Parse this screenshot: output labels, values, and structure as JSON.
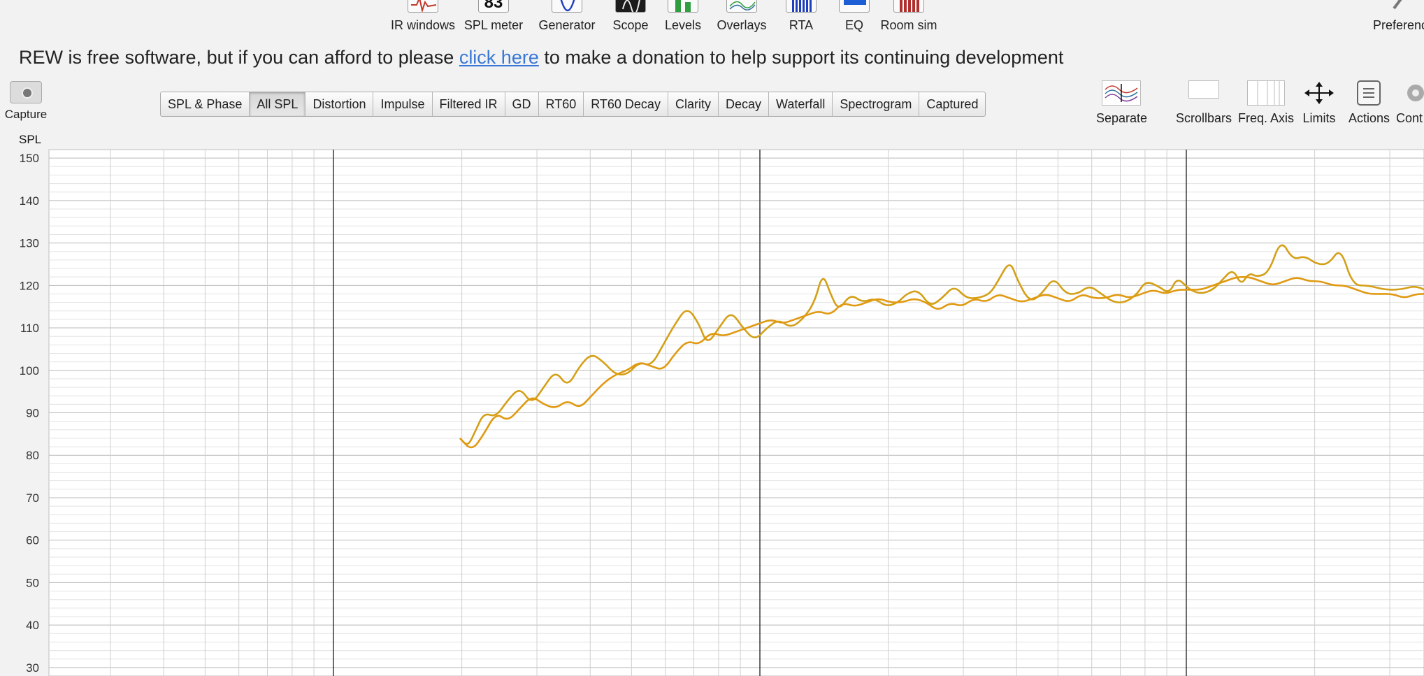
{
  "toolbar": {
    "items": [
      {
        "label": "IR windows",
        "icon": "ir-windows-icon"
      },
      {
        "label": "SPL meter",
        "icon": "spl-meter-icon",
        "display": "83"
      },
      {
        "label": "Generator",
        "icon": "generator-icon"
      },
      {
        "label": "Scope",
        "icon": "scope-icon"
      },
      {
        "label": "Levels",
        "icon": "levels-icon"
      },
      {
        "label": "Overlays",
        "icon": "overlays-icon"
      },
      {
        "label": "RTA",
        "icon": "rta-icon"
      },
      {
        "label": "EQ",
        "icon": "eq-icon"
      },
      {
        "label": "Room sim",
        "icon": "room-sim-icon"
      },
      {
        "label": "Preferenc",
        "icon": "preferences-icon"
      }
    ]
  },
  "donation": {
    "before": "REW is free software, but if you can afford to please ",
    "link": "click here",
    "after": " to make a donation to help support its continuing development"
  },
  "capture": {
    "label": "Capture",
    "icon": "camera-icon"
  },
  "tabs": {
    "items": [
      "SPL & Phase",
      "All SPL",
      "Distortion",
      "Impulse",
      "Filtered IR",
      "GD",
      "RT60",
      "RT60 Decay",
      "Clarity",
      "Decay",
      "Waterfall",
      "Spectrogram",
      "Captured"
    ],
    "active": "All SPL"
  },
  "graph_controls": {
    "items": [
      {
        "label": "Separate",
        "icon": "separate-icon"
      },
      {
        "label": "Scrollbars",
        "icon": "scrollbars-icon"
      },
      {
        "label": "Freq. Axis",
        "icon": "freq-axis-icon"
      },
      {
        "label": "Limits",
        "icon": "limits-icon"
      },
      {
        "label": "Actions",
        "icon": "actions-icon"
      },
      {
        "label": "Cont",
        "icon": "controls-icon"
      }
    ]
  },
  "colors": {
    "trace_1": "#d4a017",
    "trace_2": "#e09a12",
    "grid": "#c8c8c8",
    "grid_major": "#3a3a3a",
    "plot_bg": "#ffffff"
  },
  "chart_data": {
    "type": "line",
    "ylabel": "SPL",
    "y_ticks": [
      150,
      140,
      130,
      120,
      110,
      100,
      90,
      80,
      70,
      60,
      50,
      40,
      30
    ],
    "ylim": [
      28,
      152
    ],
    "x_scale": "log",
    "grid": true,
    "series": [
      {
        "values_note": "",
        "points": [
          [
            0.0,
            84
          ],
          [
            0.01,
            82
          ],
          [
            0.02,
            86
          ],
          [
            0.03,
            90
          ],
          [
            0.045,
            89
          ],
          [
            0.06,
            93
          ],
          [
            0.075,
            96
          ],
          [
            0.09,
            92
          ],
          [
            0.105,
            96
          ],
          [
            0.12,
            100
          ],
          [
            0.135,
            96
          ],
          [
            0.15,
            101
          ],
          [
            0.165,
            104
          ],
          [
            0.18,
            102
          ],
          [
            0.195,
            99
          ],
          [
            0.21,
            99
          ],
          [
            0.225,
            102
          ],
          [
            0.24,
            101
          ],
          [
            0.255,
            106
          ],
          [
            0.27,
            111
          ],
          [
            0.285,
            115
          ],
          [
            0.3,
            111
          ],
          [
            0.31,
            106
          ],
          [
            0.325,
            110
          ],
          [
            0.34,
            114
          ],
          [
            0.355,
            110
          ],
          [
            0.37,
            107
          ],
          [
            0.385,
            110
          ],
          [
            0.4,
            112
          ],
          [
            0.415,
            110
          ],
          [
            0.43,
            112
          ],
          [
            0.445,
            116
          ],
          [
            0.455,
            123
          ],
          [
            0.465,
            118
          ],
          [
            0.475,
            114
          ],
          [
            0.49,
            118
          ],
          [
            0.505,
            116
          ],
          [
            0.52,
            117
          ],
          [
            0.535,
            115
          ],
          [
            0.55,
            116
          ],
          [
            0.56,
            118
          ],
          [
            0.575,
            119
          ],
          [
            0.59,
            115
          ],
          [
            0.605,
            117
          ],
          [
            0.62,
            120
          ],
          [
            0.635,
            117
          ],
          [
            0.65,
            117
          ],
          [
            0.665,
            118
          ],
          [
            0.675,
            121
          ],
          [
            0.69,
            126
          ],
          [
            0.7,
            121
          ],
          [
            0.715,
            116
          ],
          [
            0.73,
            118
          ],
          [
            0.745,
            122
          ],
          [
            0.76,
            118
          ],
          [
            0.775,
            118
          ],
          [
            0.79,
            120
          ],
          [
            0.805,
            118
          ],
          [
            0.82,
            116
          ],
          [
            0.835,
            116
          ],
          [
            0.85,
            118
          ],
          [
            0.86,
            121
          ],
          [
            0.875,
            120
          ],
          [
            0.89,
            118
          ],
          [
            0.9,
            122
          ],
          [
            0.915,
            119
          ],
          [
            0.93,
            118
          ],
          [
            0.945,
            119
          ],
          [
            0.955,
            121
          ],
          [
            0.97,
            124
          ],
          [
            0.98,
            120
          ],
          [
            0.99,
            123
          ],
          [
            1.0,
            122
          ],
          [
            1.015,
            123
          ],
          [
            1.03,
            131
          ],
          [
            1.045,
            126
          ],
          [
            1.06,
            127
          ],
          [
            1.075,
            125
          ],
          [
            1.09,
            125
          ],
          [
            1.105,
            129
          ],
          [
            1.12,
            120
          ],
          [
            1.14,
            120
          ],
          [
            1.16,
            119
          ],
          [
            1.18,
            119
          ],
          [
            1.2,
            120
          ],
          [
            1.22,
            118
          ],
          [
            1.24,
            119
          ],
          [
            1.26,
            121
          ],
          [
            1.28,
            118
          ],
          [
            1.3,
            119
          ],
          [
            1.315,
            123
          ]
        ]
      },
      {
        "values_note": "",
        "points": [
          [
            0.0,
            84
          ],
          [
            0.015,
            81
          ],
          [
            0.03,
            85
          ],
          [
            0.045,
            90
          ],
          [
            0.06,
            88
          ],
          [
            0.075,
            91
          ],
          [
            0.09,
            94
          ],
          [
            0.105,
            92
          ],
          [
            0.12,
            91
          ],
          [
            0.135,
            93
          ],
          [
            0.15,
            91
          ],
          [
            0.165,
            94
          ],
          [
            0.18,
            97
          ],
          [
            0.195,
            99
          ],
          [
            0.21,
            100
          ],
          [
            0.225,
            102
          ],
          [
            0.24,
            101
          ],
          [
            0.255,
            100
          ],
          [
            0.27,
            104
          ],
          [
            0.285,
            107
          ],
          [
            0.3,
            106
          ],
          [
            0.315,
            109
          ],
          [
            0.33,
            108
          ],
          [
            0.345,
            109
          ],
          [
            0.36,
            110
          ],
          [
            0.375,
            111
          ],
          [
            0.39,
            112
          ],
          [
            0.405,
            111
          ],
          [
            0.42,
            112
          ],
          [
            0.435,
            113
          ],
          [
            0.45,
            114
          ],
          [
            0.465,
            113
          ],
          [
            0.48,
            116
          ],
          [
            0.495,
            115
          ],
          [
            0.51,
            116
          ],
          [
            0.525,
            117
          ],
          [
            0.54,
            116
          ],
          [
            0.555,
            116
          ],
          [
            0.57,
            117
          ],
          [
            0.585,
            116
          ],
          [
            0.6,
            114
          ],
          [
            0.615,
            116
          ],
          [
            0.63,
            115
          ],
          [
            0.645,
            117
          ],
          [
            0.66,
            116
          ],
          [
            0.675,
            118
          ],
          [
            0.69,
            117
          ],
          [
            0.705,
            116
          ],
          [
            0.72,
            117
          ],
          [
            0.735,
            118
          ],
          [
            0.75,
            117
          ],
          [
            0.765,
            116
          ],
          [
            0.78,
            118
          ],
          [
            0.795,
            117
          ],
          [
            0.81,
            117
          ],
          [
            0.825,
            118
          ],
          [
            0.84,
            117
          ],
          [
            0.855,
            118
          ],
          [
            0.87,
            119
          ],
          [
            0.885,
            118
          ],
          [
            0.9,
            119
          ],
          [
            0.915,
            119
          ],
          [
            0.93,
            119
          ],
          [
            0.945,
            120
          ],
          [
            0.96,
            121
          ],
          [
            0.975,
            122
          ],
          [
            0.99,
            122
          ],
          [
            1.005,
            121
          ],
          [
            1.02,
            120
          ],
          [
            1.035,
            121
          ],
          [
            1.05,
            122
          ],
          [
            1.065,
            121
          ],
          [
            1.08,
            121
          ],
          [
            1.095,
            120
          ],
          [
            1.11,
            120
          ],
          [
            1.125,
            119
          ],
          [
            1.14,
            118
          ],
          [
            1.155,
            118
          ],
          [
            1.17,
            118
          ],
          [
            1.185,
            117
          ],
          [
            1.2,
            118
          ],
          [
            1.215,
            118
          ],
          [
            1.23,
            118
          ],
          [
            1.245,
            119
          ],
          [
            1.26,
            119
          ],
          [
            1.275,
            118
          ],
          [
            1.29,
            117
          ],
          [
            1.305,
            118
          ],
          [
            1.315,
            121
          ]
        ]
      }
    ]
  }
}
